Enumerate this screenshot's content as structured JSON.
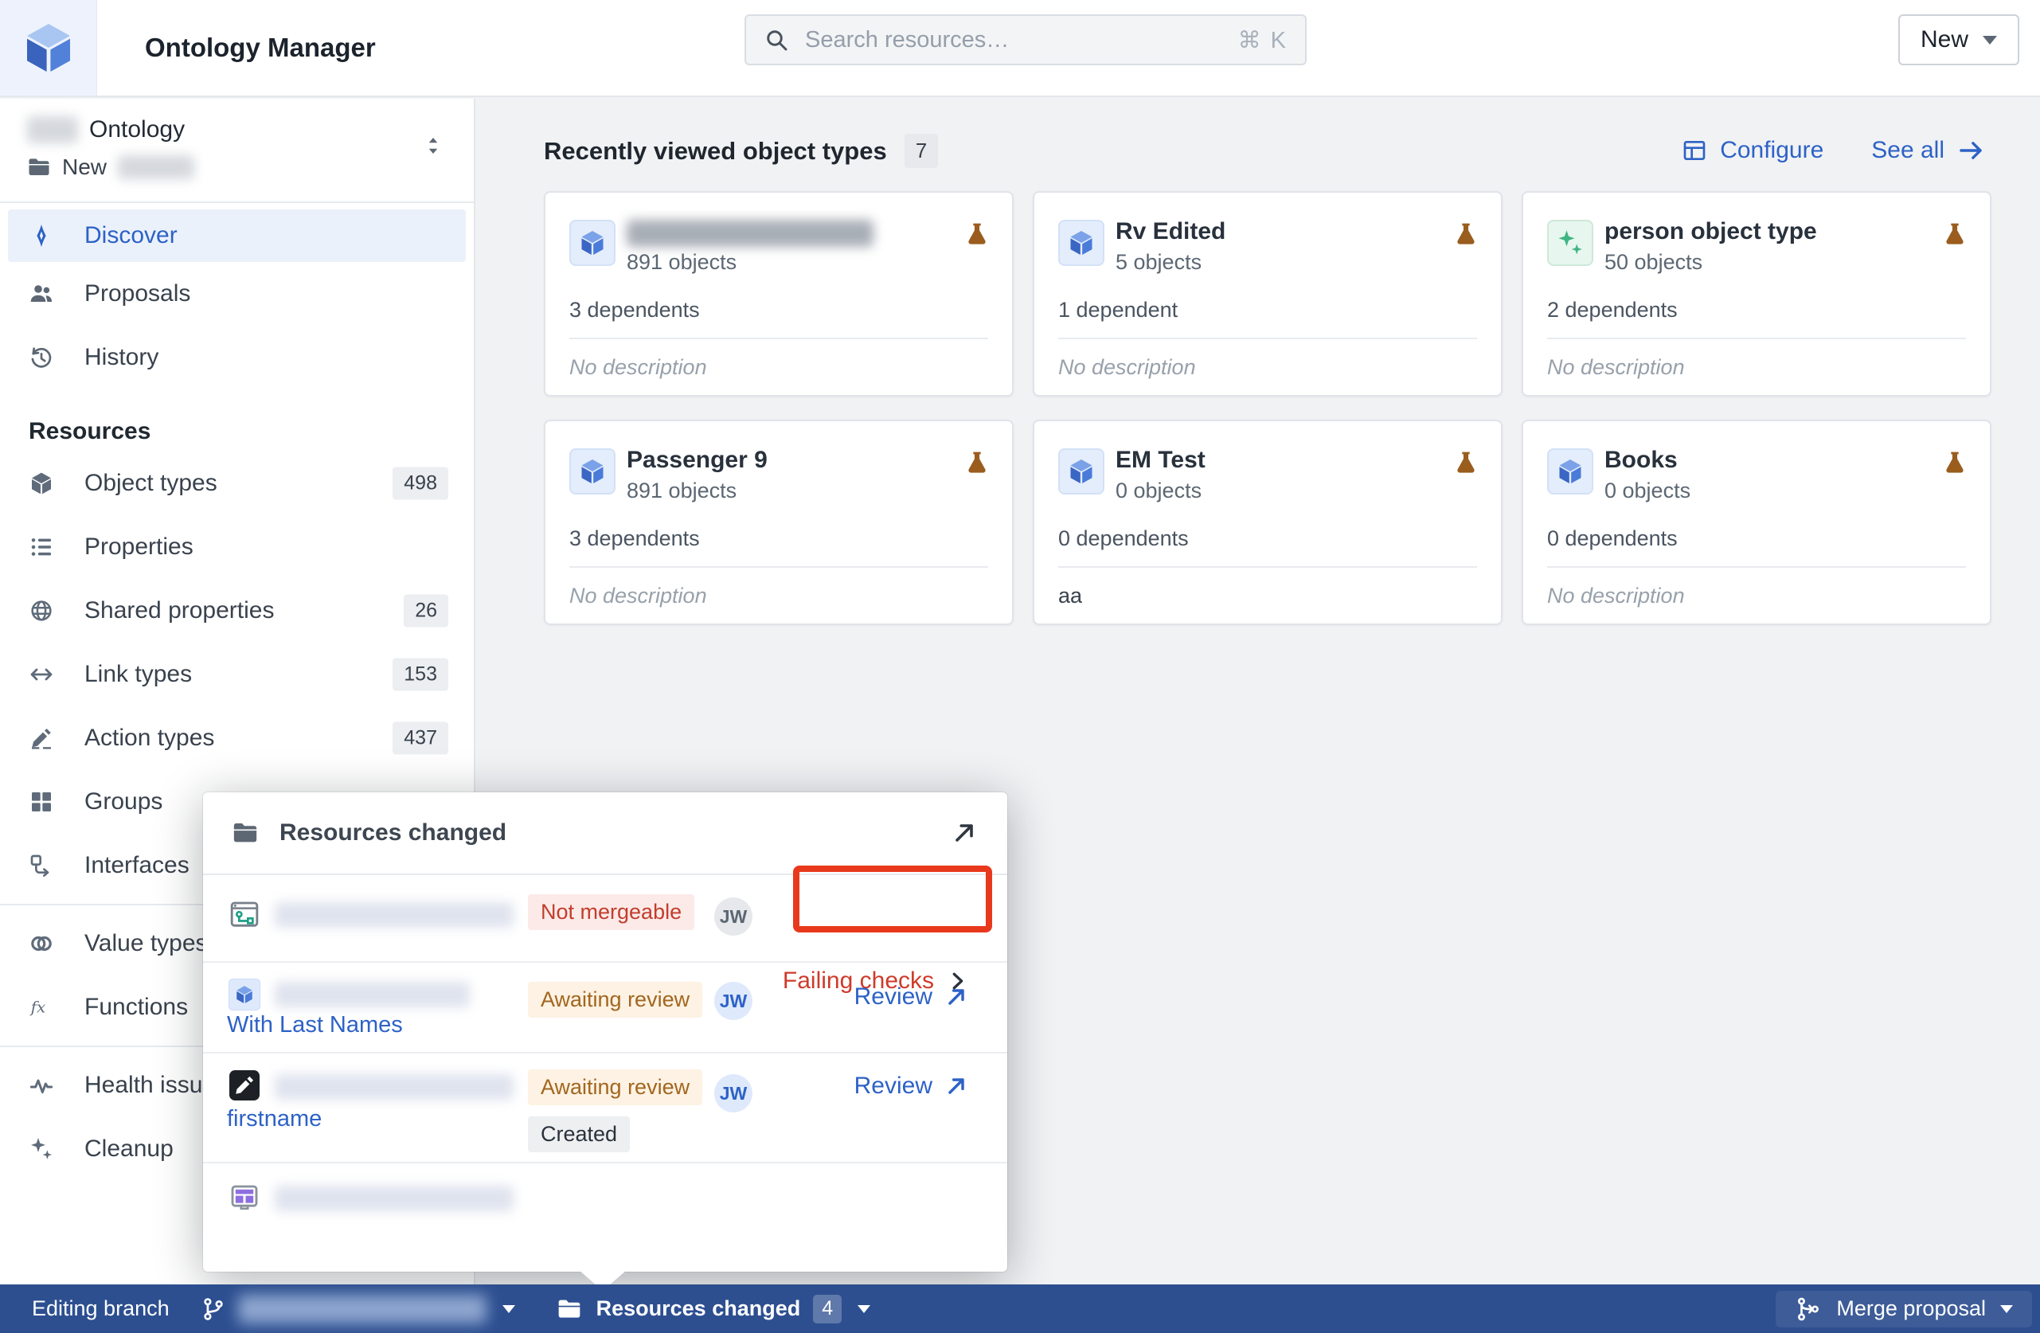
{
  "colors": {
    "accent_blue": "#2D62C6",
    "bottom_bar_blue": "#2D4F90",
    "highlight_red": "#E8391D",
    "flask_brown": "#9A5D1D",
    "badge_red_bg": "#FCEAE8",
    "badge_red_text": "#C23D2C",
    "badge_orange_bg": "#FDF2E3",
    "badge_orange_text": "#A2661F",
    "badge_gray_bg": "#EDEFF1"
  },
  "header": {
    "app_title": "Ontology Manager",
    "search_placeholder": "Search resources…",
    "search_shortcut": "⌘ K",
    "new_button_label": "New"
  },
  "sidebar": {
    "ontology_suffix": "Ontology",
    "branch_prefix": "New",
    "nav_items": [
      {
        "label": "Discover"
      },
      {
        "label": "Proposals"
      },
      {
        "label": "History"
      }
    ],
    "resources_header": "Resources",
    "resource_items": [
      {
        "label": "Object types",
        "count": "498"
      },
      {
        "label": "Properties",
        "count": ""
      },
      {
        "label": "Shared properties",
        "count": "26"
      },
      {
        "label": "Link types",
        "count": "153"
      },
      {
        "label": "Action types",
        "count": "437"
      },
      {
        "label": "Groups",
        "count": ""
      },
      {
        "label": "Interfaces",
        "count": ""
      },
      {
        "label": "Value types",
        "count": ""
      },
      {
        "label": "Functions",
        "count": ""
      },
      {
        "label": "Health issues",
        "count": ""
      },
      {
        "label": "Cleanup",
        "count": ""
      }
    ]
  },
  "main": {
    "section_title": "Recently viewed object types",
    "section_count": "7",
    "configure_label": "Configure",
    "see_all_label": "See all",
    "cards": [
      {
        "title": "",
        "objects_label": "891 objects",
        "dependents_label": "3 dependents",
        "description": "No description"
      },
      {
        "title": "Rv Edited",
        "objects_label": "5 objects",
        "dependents_label": "1 dependent",
        "description": "No description"
      },
      {
        "title": "person object type",
        "objects_label": "50 objects",
        "dependents_label": "2 dependents",
        "description": "No description"
      },
      {
        "title": "Passenger 9",
        "objects_label": "891 objects",
        "dependents_label": "3 dependents",
        "description": "No description"
      },
      {
        "title": "EM Test",
        "objects_label": "0 objects",
        "dependents_label": "0 dependents",
        "description": "aa"
      },
      {
        "title": "Books",
        "objects_label": "0 objects",
        "dependents_label": "0 dependents",
        "description": "No description"
      }
    ]
  },
  "popup": {
    "title": "Resources changed",
    "rows": [
      {
        "status_badge": "Not mergeable",
        "avatar": "JW",
        "action_label": "Failing checks"
      },
      {
        "link_label": "With Last Names",
        "status_badge": "Awaiting review",
        "avatar": "JW",
        "action_label": "Review"
      },
      {
        "link_label": "firstname",
        "status_badge": "Awaiting review",
        "change_badge": "Created",
        "avatar": "JW",
        "action_label": "Review"
      },
      {}
    ]
  },
  "bottom_bar": {
    "editing_branch_label": "Editing branch",
    "resources_changed_label": "Resources changed",
    "resources_changed_count": "4",
    "merge_proposal_label": "Merge proposal"
  }
}
